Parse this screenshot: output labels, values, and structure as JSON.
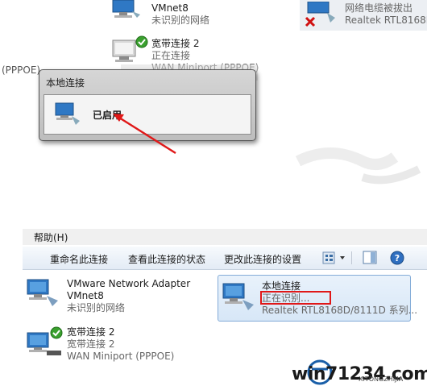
{
  "top_list": {
    "vmnet8": {
      "name": "VMnet8",
      "status": "未识别的网络"
    },
    "broadband": {
      "name": "宽带连接 2",
      "status": "正在连接",
      "device": "WAN Miniport (PPPOE)"
    },
    "local_top_right": {
      "status": "网络电缆被拔出",
      "device": "Realtek RTL8168D/"
    },
    "ppoe_fragment": "(PPPOE)"
  },
  "tooltip": {
    "title": "本地连接",
    "status": "已启用"
  },
  "window": {
    "menu": {
      "help": "帮助(H)"
    },
    "toolbar": {
      "rename": "重命名此连接",
      "view_status": "查看此连接的状态",
      "change_settings": "更改此连接的设置"
    },
    "items": [
      {
        "name": "VMware Network Adapter",
        "name2": "VMnet8",
        "status": "未识别的网络"
      },
      {
        "name": "本地连接",
        "status": "正在识别...",
        "device": "Realtek RTL8168D/8111D 系列..."
      },
      {
        "name": "宽带连接 2",
        "status": "宽带连接 2",
        "device": "WAN Miniport (PPPOE)"
      }
    ]
  },
  "watermark": {
    "text": "win71234.com",
    "sub": "XITONGZHIJIA"
  },
  "colors": {
    "highlight_red": "#e01818",
    "arrow_red": "#e01818",
    "selection_blue": "#84acd8"
  }
}
